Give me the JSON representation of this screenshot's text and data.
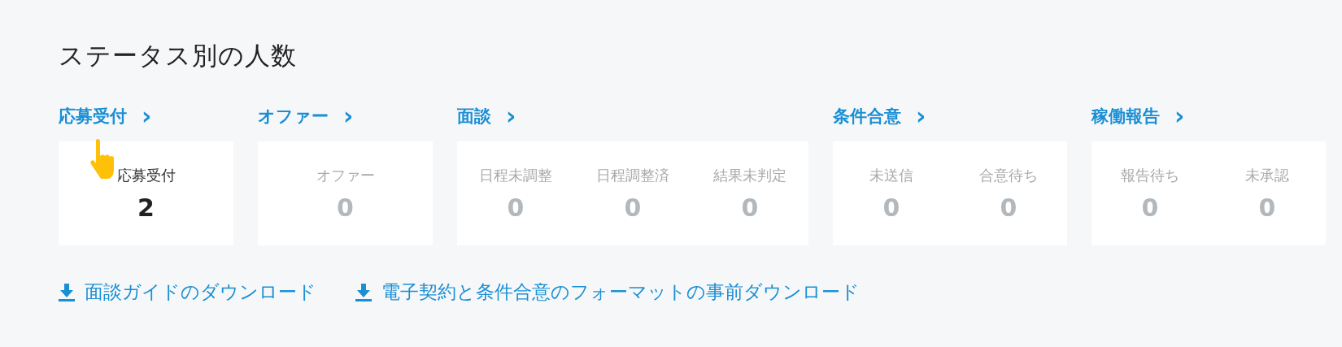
{
  "title": "ステータス別の人数",
  "groups": [
    {
      "label": "応募受付",
      "arrow": "›",
      "items": [
        {
          "label": "応募受付",
          "count": "2",
          "active": true
        }
      ]
    },
    {
      "label": "オファー",
      "arrow": "›",
      "items": [
        {
          "label": "オファー",
          "count": "0",
          "active": false
        }
      ]
    },
    {
      "label": "面談",
      "arrow": "›",
      "items": [
        {
          "label": "日程未調整",
          "count": "0",
          "active": false
        },
        {
          "label": "日程調整済",
          "count": "0",
          "active": false
        },
        {
          "label": "結果未判定",
          "count": "0",
          "active": false
        }
      ]
    },
    {
      "label": "条件合意",
      "arrow": "›",
      "items": [
        {
          "label": "未送信",
          "count": "0",
          "active": false
        },
        {
          "label": "合意待ち",
          "count": "0",
          "active": false
        }
      ]
    },
    {
      "label": "稼働報告",
      "arrow": "›",
      "items": [
        {
          "label": "報告待ち",
          "count": "0",
          "active": false
        },
        {
          "label": "未承認",
          "count": "0",
          "active": false
        }
      ]
    }
  ],
  "downloads": [
    {
      "label": "面談ガイドのダウンロード"
    },
    {
      "label": "電子契約と条件合意のフォーマットの事前ダウンロード"
    }
  ]
}
